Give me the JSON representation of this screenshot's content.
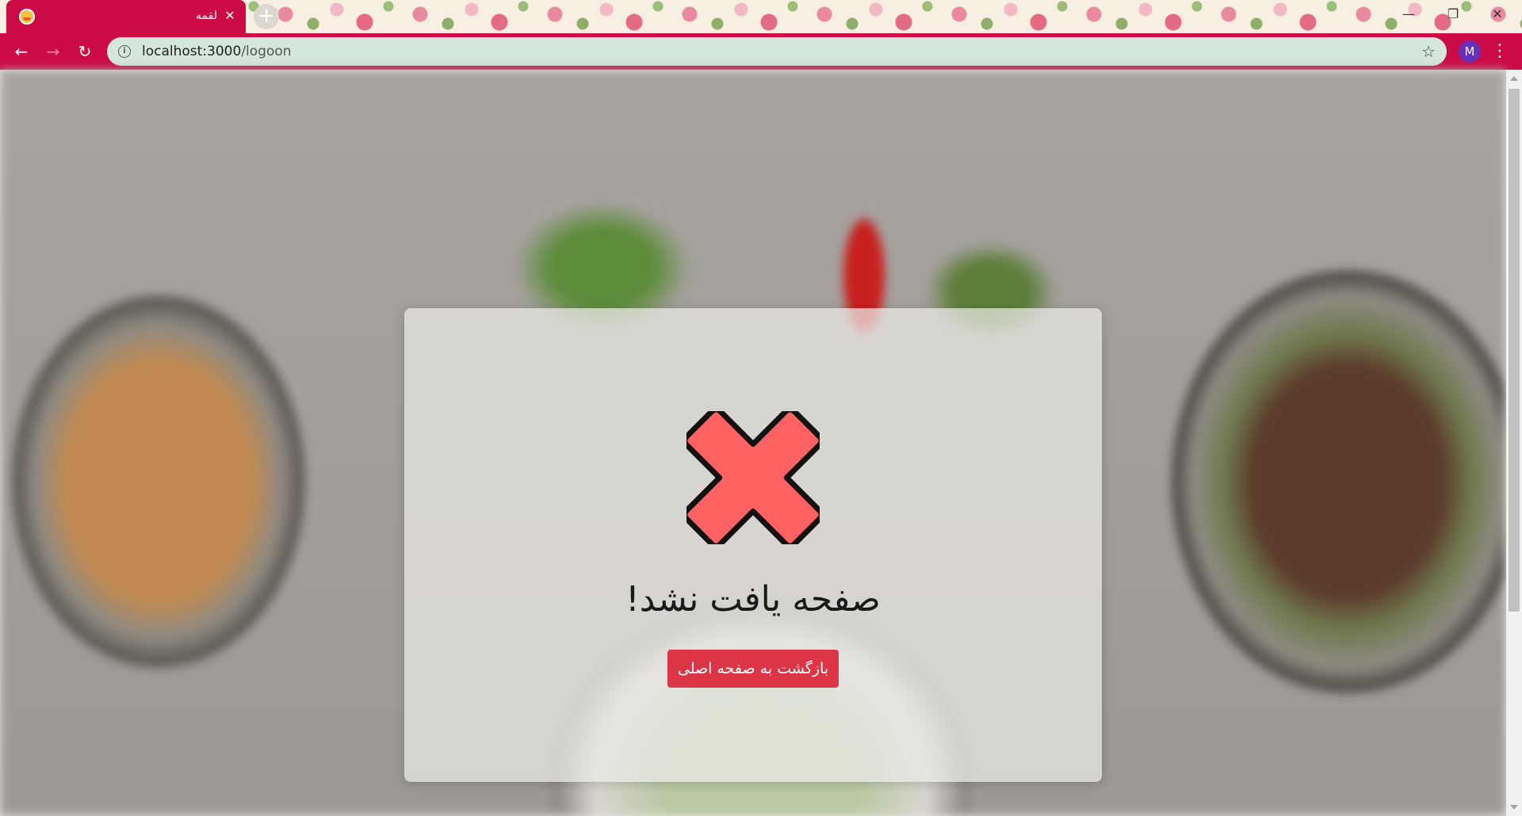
{
  "browser": {
    "tab": {
      "title": "لقمه",
      "favicon": "food-favicon",
      "close_label": "✕"
    },
    "new_tab_label": "+",
    "window_controls": {
      "minimize": "—",
      "restore": "❐",
      "close": "✕"
    },
    "nav": {
      "back": "←",
      "forward": "→",
      "reload": "↻"
    },
    "address": {
      "host": "localhost:3000",
      "path": "/logoon"
    },
    "info_icon": "i",
    "bookmark_icon": "☆",
    "profile_initial": "M",
    "menu_icon": "⋮",
    "accent_color": "#cc0a45"
  },
  "page": {
    "status_icon": "x-mark-icon",
    "message": "صفحه یافت نشد!",
    "home_button_label": "بازگشت به صفحه اصلی",
    "button_color": "#dc3545",
    "icon_color": "#fe6263"
  }
}
